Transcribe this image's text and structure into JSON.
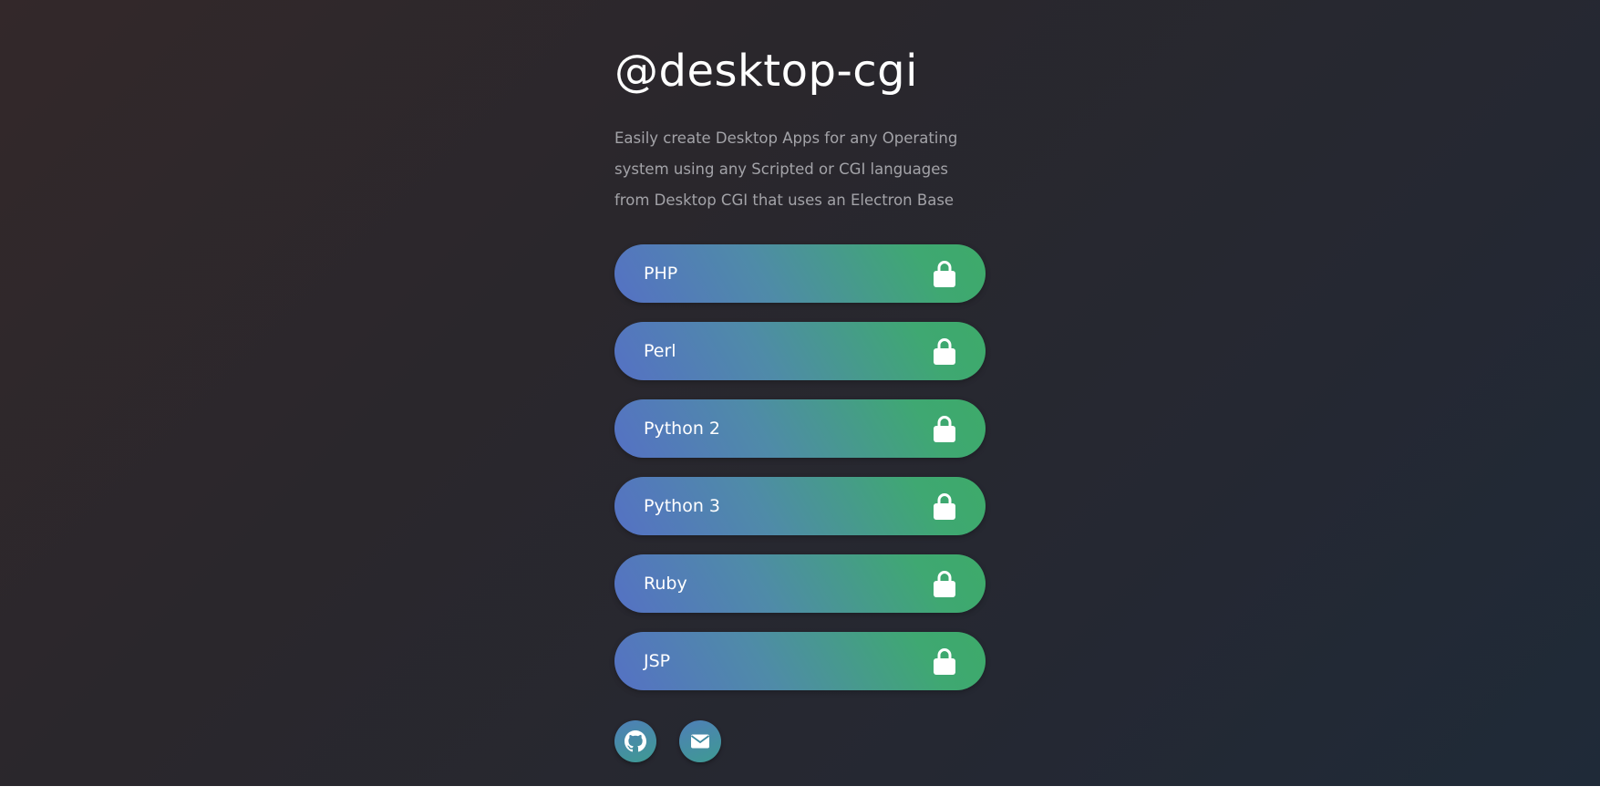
{
  "profile": {
    "title": "@desktop-cgi",
    "description_lines": [
      "Easily create Desktop Apps for any Operating",
      "system using any Scripted or CGI languages",
      "from Desktop CGI that uses an Electron Base"
    ]
  },
  "links": [
    {
      "label": "PHP",
      "icon": "lock-icon"
    },
    {
      "label": "Perl",
      "icon": "lock-icon"
    },
    {
      "label": "Python 2",
      "icon": "lock-icon"
    },
    {
      "label": "Python 3",
      "icon": "lock-icon"
    },
    {
      "label": "Ruby",
      "icon": "lock-icon"
    },
    {
      "label": "JSP",
      "icon": "lock-icon"
    }
  ],
  "socials": [
    {
      "icon": "github-icon"
    },
    {
      "icon": "mail-icon"
    }
  ],
  "colors": {
    "background_start": "#33282a",
    "background_end": "#1f2a38",
    "button_gradient_start": "#5571c4",
    "button_gradient_end": "#3daa6a",
    "title_text": "#ffffff",
    "description_text": "#a3a3a8"
  }
}
